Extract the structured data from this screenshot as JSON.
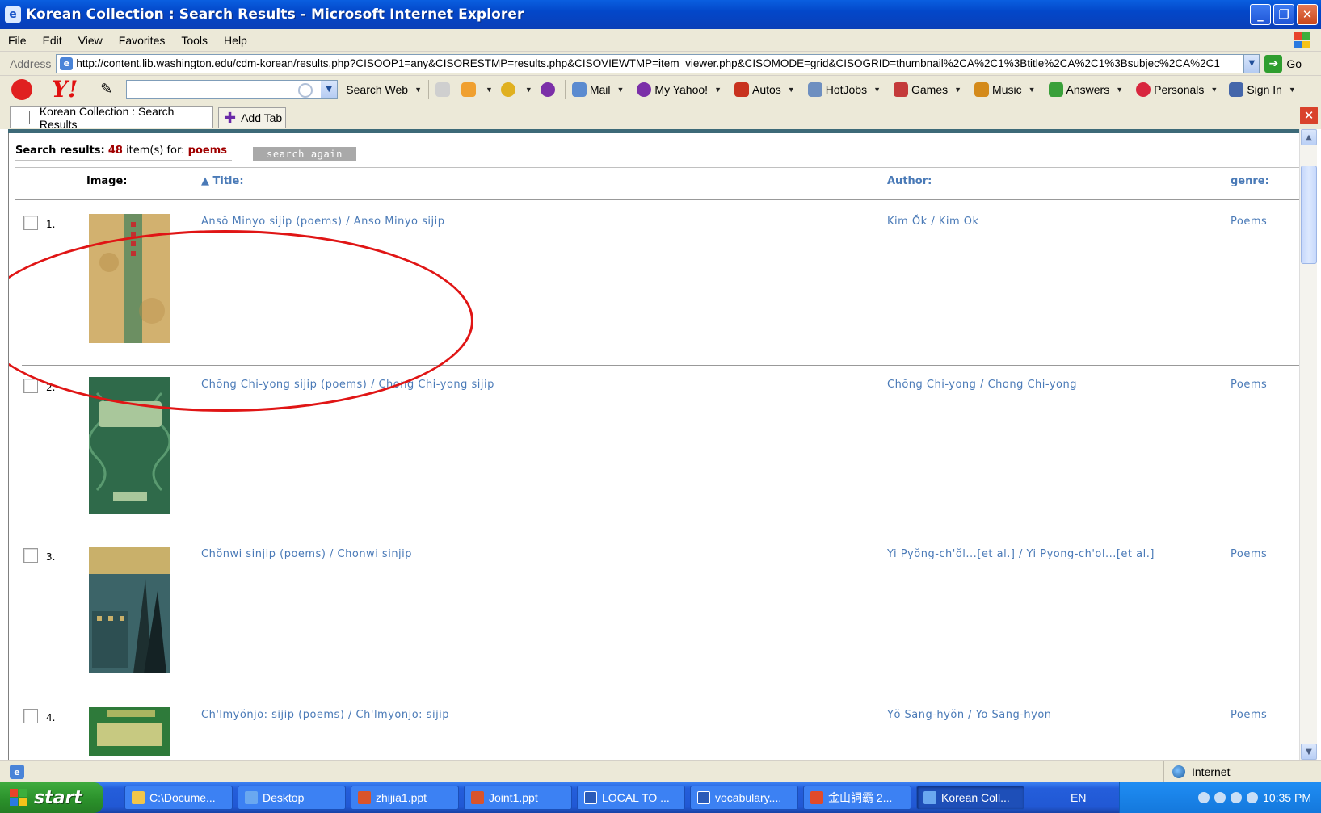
{
  "window": {
    "title": "Korean Collection : Search Results - Microsoft Internet Explorer",
    "buttons": {
      "minimize": "_",
      "maximize": "❐",
      "close": "✕"
    }
  },
  "menu": [
    "File",
    "Edit",
    "View",
    "Favorites",
    "Tools",
    "Help"
  ],
  "address": {
    "label": "Address",
    "url": "http://content.lib.washington.edu/cdm-korean/results.php?CISOOP1=any&CISORESTMP=results.php&CISOVIEWTMP=item_viewer.php&CISOMODE=grid&CISOGRID=thumbnail%2CA%2C1%3Btitle%2CA%2C1%3Bsubjec%2CA%2C1",
    "go": "Go"
  },
  "yahoo_toolbar": {
    "logo": "Y!",
    "search_web": "Search Web",
    "items": [
      {
        "label": "Mail",
        "icon": "mail-icon",
        "color": "#5b8bd0"
      },
      {
        "label": "My Yahoo!",
        "icon": "my-yahoo-icon",
        "color": "#7b2fa8"
      },
      {
        "label": "Autos",
        "icon": "car-icon",
        "color": "#c8321e"
      },
      {
        "label": "HotJobs",
        "icon": "hotjobs-icon",
        "color": "#6e8fc0"
      },
      {
        "label": "Games",
        "icon": "games-icon",
        "color": "#c43a3a"
      },
      {
        "label": "Music",
        "icon": "music-icon",
        "color": "#d48a1a"
      },
      {
        "label": "Answers",
        "icon": "answers-icon",
        "color": "#3aa03a"
      },
      {
        "label": "Personals",
        "icon": "heart-icon",
        "color": "#d8263e"
      },
      {
        "label": "Sign In",
        "icon": "sign-in-icon",
        "color": "#4466aa"
      }
    ]
  },
  "tabs": {
    "active": "Korean Collection : Search Results",
    "add": "Add Tab"
  },
  "results": {
    "prefix": "Search results:",
    "count": "48",
    "middle": "item(s) for:",
    "query": "poems",
    "search_again": "search again",
    "columns": {
      "image": "Image:",
      "title": "▲ Title:",
      "author": "Author:",
      "genre": "genre:"
    },
    "rows": [
      {
        "num": "1.",
        "title": "Ansŏ Minyo sijip (poems) / Anso Minyo sijip",
        "author": "Kim Ŏk / Kim Ok",
        "genre": "Poems",
        "cover": "cover-1"
      },
      {
        "num": "2.",
        "title": "Chŏng Chi-yong sijip (poems) / Chong Chi-yong sijip",
        "author": "Chŏng Chi-yong / Chong Chi-yong",
        "genre": "Poems",
        "cover": "cover-2"
      },
      {
        "num": "3.",
        "title": "Chŏnwi sinjip (poems) / Chonwi sinjip",
        "author": "Yi Pyŏng-ch'ŏl...[et al.] / Yi Pyong-ch'ol...[et al.]",
        "genre": "Poems",
        "cover": "cover-3"
      },
      {
        "num": "4.",
        "title": "Ch'lmyŏnjo: sijip (poems) / Ch'lmyonjo: sijip",
        "author": "Yŏ Sang-hyŏn / Yo Sang-hyon",
        "genre": "Poems",
        "cover": "cover-4"
      }
    ]
  },
  "status": {
    "zone": "Internet"
  },
  "taskbar": {
    "start": "start",
    "tasks": [
      {
        "label": "C:\\Docume...",
        "color": "#f2c64a"
      },
      {
        "label": "Desktop",
        "color": "#6aa8f0"
      },
      {
        "label": "zhijia1.ppt",
        "color": "#d9542b"
      },
      {
        "label": "Joint1.ppt",
        "color": "#d9542b"
      },
      {
        "label": "LOCAL TO ...",
        "color": "#2a5bb8"
      },
      {
        "label": "vocabulary....",
        "color": "#2a5bb8"
      },
      {
        "label": "金山詞霸 2...",
        "color": "#e04a2a"
      },
      {
        "label": "Korean Coll...",
        "color": "#6aa8f0"
      }
    ],
    "lang": "EN",
    "clock": "10:35 PM"
  }
}
